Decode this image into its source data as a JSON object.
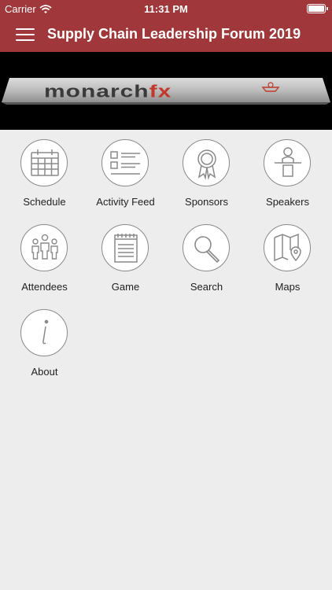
{
  "status_bar": {
    "carrier": "Carrier",
    "time": "11:31 PM"
  },
  "nav": {
    "title": "Supply Chain Leadership Forum 2019"
  },
  "banner": {
    "brand": "monarch",
    "brand_accent": "fx"
  },
  "colors": {
    "nav_bg": "#a0373a",
    "icon_stroke": "#8a8a8a",
    "page_bg": "#ededed"
  },
  "menu": [
    {
      "label": "Schedule",
      "icon": "calendar-icon"
    },
    {
      "label": "Activity Feed",
      "icon": "list-icon"
    },
    {
      "label": "Sponsors",
      "icon": "award-ribbon-icon"
    },
    {
      "label": "Speakers",
      "icon": "speaker-podium-icon"
    },
    {
      "label": "Attendees",
      "icon": "people-group-icon"
    },
    {
      "label": "Game",
      "icon": "notepad-icon"
    },
    {
      "label": "Search",
      "icon": "magnifier-icon"
    },
    {
      "label": "Maps",
      "icon": "map-pin-icon"
    },
    {
      "label": "About",
      "icon": "info-icon"
    }
  ]
}
